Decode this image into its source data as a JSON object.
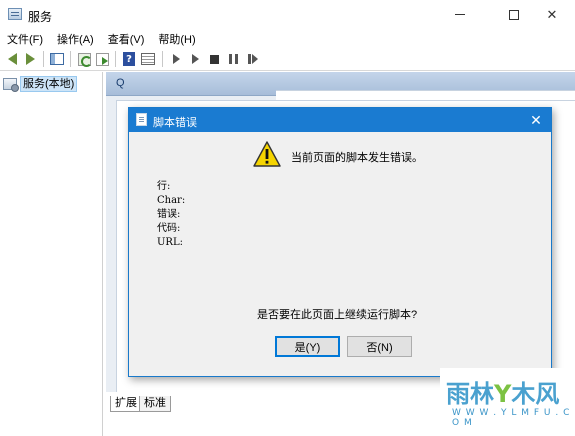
{
  "window": {
    "title": "服务",
    "minimize_glyph": "",
    "close_glyph": "✕"
  },
  "menu": {
    "items": [
      {
        "label": "文件(F)"
      },
      {
        "label": "操作(A)"
      },
      {
        "label": "查看(V)"
      },
      {
        "label": "帮助(H)"
      }
    ]
  },
  "toolbar": {
    "icons": [
      "back-icon",
      "forward-icon",
      "show-pane-icon",
      "refresh-icon",
      "export-icon",
      "help-icon",
      "properties-icon",
      "start-icon",
      "start-alt-icon",
      "stop-icon",
      "pause-icon",
      "restart-icon"
    ],
    "help_glyph": "?"
  },
  "tree": {
    "root_label": "服务(本地)"
  },
  "pane": {
    "header_glyph": "Q"
  },
  "tabs": [
    {
      "label": "扩展"
    },
    {
      "label": "标准"
    }
  ],
  "dialog": {
    "title": "脚本错误",
    "close_glyph": "✕",
    "message": "当前页面的脚本发生错误。",
    "fields": [
      {
        "label": "行:"
      },
      {
        "label": "Char:"
      },
      {
        "label": "错误:"
      },
      {
        "label": "代码:"
      },
      {
        "label": "URL:"
      }
    ],
    "question": "是否要在此页面上继续运行脚本?",
    "yes_label": "是(Y)",
    "no_label": "否(N)",
    "accent_color": "#1a7bd1"
  },
  "watermark": {
    "main_before": "雨林",
    "main_y": "Y",
    "main_after": "木风",
    "sub": "W W W . Y L M F U . C O M"
  }
}
